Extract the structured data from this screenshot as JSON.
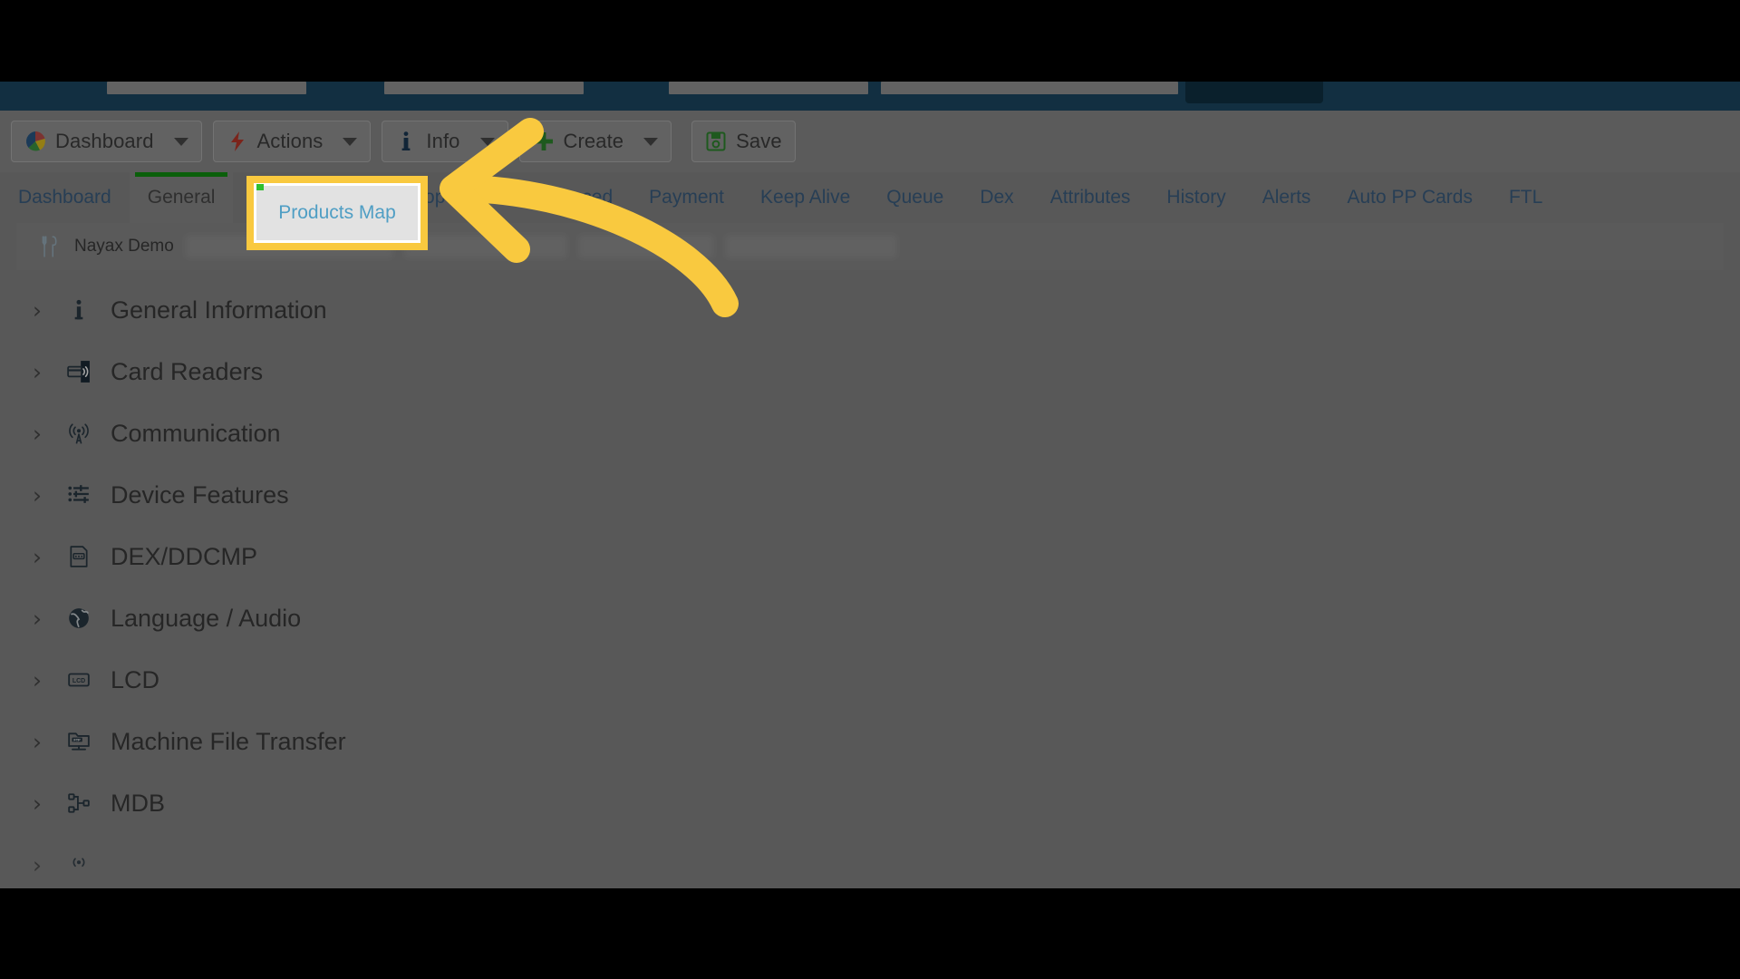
{
  "window": {
    "background_color": "#8a8a8a",
    "navbar_color": "#1d4a66",
    "highlight_color": "#f9c93f",
    "accent_link_color": "#3d6285",
    "active_tab_indicator_color": "#119511"
  },
  "topnav": {
    "items": [
      {
        "name": "nav-item-1",
        "active": false
      },
      {
        "name": "nav-item-2",
        "active": false
      },
      {
        "name": "nav-item-3",
        "active": false
      },
      {
        "name": "nav-item-4",
        "active": false
      },
      {
        "name": "nav-item-5",
        "active": true
      }
    ]
  },
  "toolbar": {
    "buttons": [
      {
        "label": "Dashboard",
        "icon": "pie-chart-icon",
        "has_caret": true
      },
      {
        "label": "Actions",
        "icon": "lightning-bolt-icon",
        "has_caret": true
      },
      {
        "label": "Info",
        "icon": "info-icon",
        "has_caret": true
      },
      {
        "label": "Create",
        "icon": "plus-icon",
        "has_caret": true
      },
      {
        "label": "Save",
        "icon": "floppy-disk-icon",
        "has_caret": false
      }
    ]
  },
  "tabs": {
    "selected": "General",
    "items": [
      {
        "label": "Dashboard",
        "active": false
      },
      {
        "label": "General",
        "active": true
      },
      {
        "label": "Products Map",
        "active": false
      },
      {
        "label": "Properties",
        "active": false
      },
      {
        "label": "Advanced",
        "active": false
      },
      {
        "label": "Payment",
        "active": false
      },
      {
        "label": "Keep Alive",
        "active": false
      },
      {
        "label": "Queue",
        "active": false
      },
      {
        "label": "Dex",
        "active": false
      },
      {
        "label": "Attributes",
        "active": false
      },
      {
        "label": "History",
        "active": false
      },
      {
        "label": "Alerts",
        "active": false
      },
      {
        "label": "Auto PP Cards",
        "active": false
      },
      {
        "label": "FTL",
        "active": false
      }
    ]
  },
  "device": {
    "name": "Nayax Demo",
    "icon": "fork-knife-icon"
  },
  "tree": {
    "items": [
      {
        "label": "General Information",
        "icon": "info-icon",
        "expanded": false
      },
      {
        "label": "Card Readers",
        "icon": "card-reader-icon",
        "expanded": false
      },
      {
        "label": "Communication",
        "icon": "antenna-icon",
        "expanded": false
      },
      {
        "label": "Device Features",
        "icon": "sliders-icon",
        "expanded": false
      },
      {
        "label": "DEX/DDCMP",
        "icon": "document-icon",
        "expanded": false
      },
      {
        "label": "Language / Audio",
        "icon": "globe-icon",
        "expanded": false
      },
      {
        "label": "LCD",
        "icon": "lcd-icon",
        "expanded": false
      },
      {
        "label": "Machine File Transfer",
        "icon": "ftp-folder-icon",
        "expanded": false
      },
      {
        "label": "MDB",
        "icon": "node-tree-icon",
        "expanded": false
      }
    ]
  },
  "annotation": {
    "highlight_target": "Products Map",
    "arrow": "curved-left-arrow",
    "arrow_color": "#f9c93f"
  }
}
